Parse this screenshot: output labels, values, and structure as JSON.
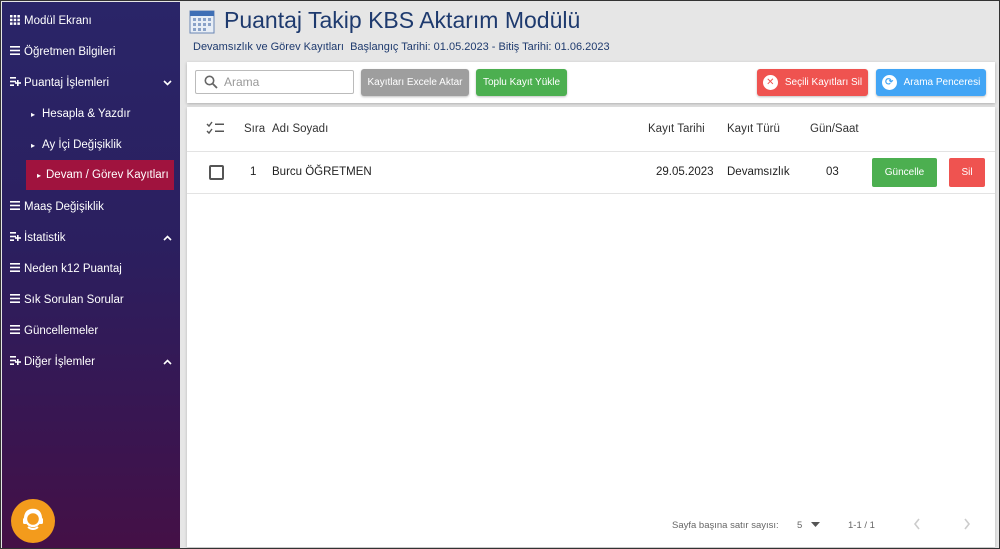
{
  "sidebar": {
    "items": [
      {
        "label": "Modül Ekranı",
        "icon": "grid-icon"
      },
      {
        "label": "Öğretmen Bilgileri",
        "icon": "list-icon"
      },
      {
        "label": "Puantaj İşlemleri",
        "icon": "playlist-icon",
        "chevron": "down"
      },
      {
        "label": "Hesapla & Yazdır",
        "icon": "triangle-right-icon"
      },
      {
        "label": "Ay İçi Değişiklik",
        "icon": "triangle-right-icon"
      },
      {
        "label": "Devam / Görev Kayıtları",
        "icon": "triangle-right-icon",
        "active": true
      },
      {
        "label": "Maaş Değişiklik",
        "icon": "list-icon"
      },
      {
        "label": "İstatistik",
        "icon": "playlist-icon",
        "chevron": "up"
      },
      {
        "label": "Neden k12 Puantaj",
        "icon": "list-icon"
      },
      {
        "label": "Sık Sorulan Sorular",
        "icon": "list-icon"
      },
      {
        "label": "Güncellemeler",
        "icon": "list-icon"
      },
      {
        "label": "Diğer İşlemler",
        "icon": "playlist-icon",
        "chevron": "up"
      }
    ],
    "active_color": "#a0133e",
    "support_icon": "support-agent-icon"
  },
  "header": {
    "title": "Puantaj Takip KBS Aktarım Modülü",
    "subtitle": "Devamsızlık ve Görev Kayıtları  Başlangıç Tarihi: 01.05.2023 - Bitiş Tarihi: 01.06.2023"
  },
  "toolbar": {
    "search_placeholder": "Arama",
    "export_label": "Kayıtları Excele Aktar",
    "bulk_upload_label": "Toplu Kayıt Yükle",
    "delete_selected_label": "Seçili Kayıtları Sil",
    "search_window_label": "Arama Penceresi",
    "colors": {
      "export": "#9e9e9e",
      "bulk": "#4caf50",
      "delete": "#ef5350",
      "search": "#42a5f5"
    }
  },
  "table": {
    "columns": [
      "Sıra",
      "Adı Soyadı",
      "Kayıt Tarihi",
      "Kayıt Türü",
      "Gün/Saat"
    ],
    "rows": [
      {
        "sira": "1",
        "ad_soyad": "Burcu ÖĞRETMEN",
        "kayit_tarihi": "29.05.2023",
        "kayit_turu": "Devamsızlık",
        "gun_saat": "03",
        "update_label": "Güncelle",
        "delete_label": "Sil"
      }
    ]
  },
  "footer": {
    "rows_per_page_label": "Sayfa başına satır sayısı:",
    "rows_per_page_value": "5",
    "range": "1-1 / 1"
  }
}
